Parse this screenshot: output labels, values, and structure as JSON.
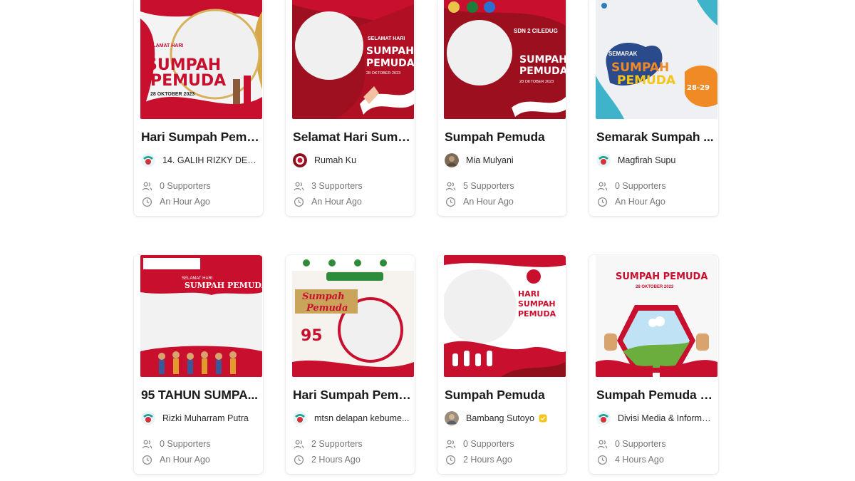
{
  "campaigns": [
    {
      "title": "Hari Sumpah Pemu...",
      "creator": "14. GALIH RIZKY DEWA...",
      "supporters": "0 Supporters",
      "time": "An Hour Ago",
      "avatar": "logo-avatar-icon",
      "verified": false,
      "frame": "red-white-ribbon-frame"
    },
    {
      "title": "Selamat Hari Sump...",
      "creator": "Rumah Ku",
      "supporters": "3 Supporters",
      "time": "An Hour Ago",
      "avatar": "red-logo-avatar-icon",
      "verified": false,
      "frame": "dark-red-frame"
    },
    {
      "title": "Sumpah Pemuda",
      "creator": "Mia Mulyani",
      "supporters": "5 Supporters",
      "time": "An Hour Ago",
      "avatar": "photo-avatar-icon",
      "verified": false,
      "frame": "dark-red-school-frame"
    },
    {
      "title": "Semarak Sumpah ...",
      "creator": "Magfirah Supu",
      "supporters": "0 Supporters",
      "time": "An Hour Ago",
      "avatar": "logo-avatar-icon",
      "verified": false,
      "frame": "white-blue-orange-frame"
    },
    {
      "title": "95 TAHUN SUMPA...",
      "creator": "Rizki Muharram Putra",
      "supporters": "0 Supporters",
      "time": "An Hour Ago",
      "avatar": "logo-avatar-icon",
      "verified": false,
      "frame": "red-crowd-frame"
    },
    {
      "title": "Hari Sumpah Pemu...",
      "creator": "mtsn delapan kebume...",
      "supporters": "2 Supporters",
      "time": "2 Hours Ago",
      "avatar": "logo-avatar-icon",
      "verified": false,
      "frame": "white-gold-95-frame"
    },
    {
      "title": "Sumpah Pemuda",
      "creator": "Bambang Sutoyo",
      "supporters": "0 Supporters",
      "time": "2 Hours Ago",
      "avatar": "photo-avatar-icon",
      "verified": true,
      "frame": "red-fist-frame"
    },
    {
      "title": "Sumpah Pemuda 2...",
      "creator": "Divisi Media & Informas...",
      "supporters": "0 Supporters",
      "time": "4 Hours Ago",
      "avatar": "logo-avatar-icon",
      "verified": false,
      "frame": "hexagon-landscape-frame"
    }
  ],
  "frame_texts": {
    "c0": {
      "top": "SELAMAT HARI",
      "main": "SUMPAH\nPEMUDA",
      "date": "28 OKTOBER 2023"
    },
    "c1": {
      "top": "SELAMAT HARI",
      "main": "SUMPAH\nPEMUDA",
      "date": "28 OKTOBER 2023"
    },
    "c2": {
      "top": "SDN 2 CILEDUG",
      "main": "SUMPAH\nPEMUDA",
      "date": "28 OKTOBER 2023"
    },
    "c3": {
      "top": "SEMARAK",
      "main": "SUMPAH\nPEMUDA",
      "date": "28-29"
    },
    "c4": {
      "top": "SELAMAT HARI",
      "main": "SUMPAH PEMUDA"
    },
    "c5": {
      "main": "Sumpah\nPemuda",
      "number": "95"
    },
    "c6": {
      "main": "HARI\nSUMPAH\nPEMUDA"
    },
    "c7": {
      "main": "SUMPAH PEMUDA",
      "date": "28 OKTOBER 2023"
    }
  },
  "colors": {
    "brand_red": "#c8102e",
    "dark_red": "#8f0f1a",
    "text_dark": "#1b1b1b",
    "text_muted": "#777777",
    "verified": "#f5c518"
  }
}
